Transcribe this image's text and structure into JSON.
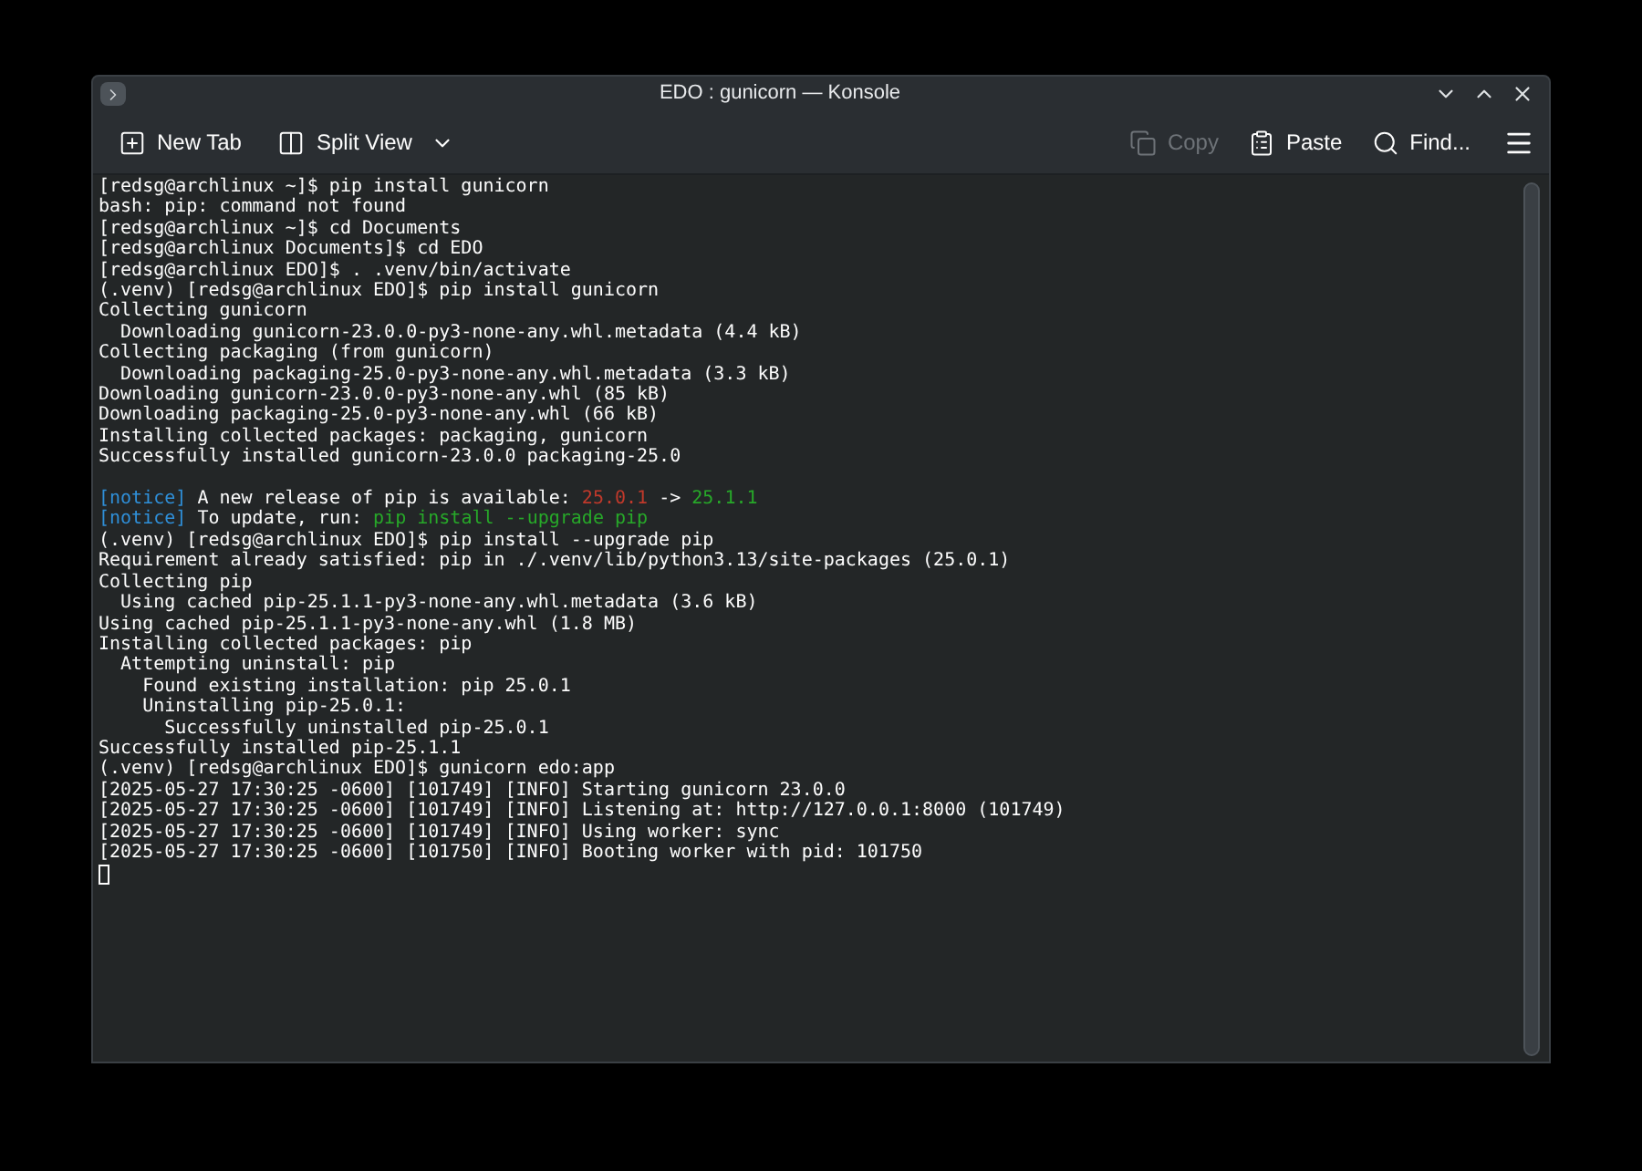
{
  "window": {
    "title": "EDO : gunicorn — Konsole"
  },
  "toolbar": {
    "left": [
      {
        "label": "New Tab",
        "kind": "newtab",
        "disabled": false
      },
      {
        "label": "Split View",
        "kind": "split",
        "disabled": false
      }
    ],
    "right": [
      {
        "label": "Copy",
        "kind": "copy",
        "disabled": true
      },
      {
        "label": "Paste",
        "kind": "paste",
        "disabled": false
      },
      {
        "label": "Find...",
        "kind": "find",
        "disabled": false
      }
    ]
  },
  "terminal": {
    "lines": [
      {
        "kind": "text",
        "spans": [
          {
            "text": "[redsg@archlinux ~]$ pip install gunicorn",
            "color": "#fcfcfc"
          }
        ]
      },
      {
        "kind": "text",
        "spans": [
          {
            "text": "bash: pip: command not found",
            "color": "#fcfcfc"
          }
        ]
      },
      {
        "kind": "text",
        "spans": [
          {
            "text": "[redsg@archlinux ~]$ cd Documents",
            "color": "#fcfcfc"
          }
        ]
      },
      {
        "kind": "text",
        "spans": [
          {
            "text": "[redsg@archlinux Documents]$ cd EDO",
            "color": "#fcfcfc"
          }
        ]
      },
      {
        "kind": "text",
        "spans": [
          {
            "text": "[redsg@archlinux EDO]$ . .venv/bin/activate",
            "color": "#fcfcfc"
          }
        ]
      },
      {
        "kind": "text",
        "spans": [
          {
            "text": "(.venv) [redsg@archlinux EDO]$ pip install gunicorn",
            "color": "#fcfcfc"
          }
        ]
      },
      {
        "kind": "text",
        "spans": [
          {
            "text": "Collecting gunicorn",
            "color": "#fcfcfc"
          }
        ]
      },
      {
        "kind": "text",
        "spans": [
          {
            "text": "  Downloading gunicorn-23.0.0-py3-none-any.whl.metadata (4.4 kB)",
            "color": "#fcfcfc"
          }
        ]
      },
      {
        "kind": "text",
        "spans": [
          {
            "text": "Collecting packaging (from gunicorn)",
            "color": "#fcfcfc"
          }
        ]
      },
      {
        "kind": "text",
        "spans": [
          {
            "text": "  Downloading packaging-25.0-py3-none-any.whl.metadata (3.3 kB)",
            "color": "#fcfcfc"
          }
        ]
      },
      {
        "kind": "text",
        "spans": [
          {
            "text": "Downloading gunicorn-23.0.0-py3-none-any.whl (85 kB)",
            "color": "#fcfcfc"
          }
        ]
      },
      {
        "kind": "text",
        "spans": [
          {
            "text": "Downloading packaging-25.0-py3-none-any.whl (66 kB)",
            "color": "#fcfcfc"
          }
        ]
      },
      {
        "kind": "text",
        "spans": [
          {
            "text": "Installing collected packages: packaging, gunicorn",
            "color": "#fcfcfc"
          }
        ]
      },
      {
        "kind": "text",
        "spans": [
          {
            "text": "Successfully installed gunicorn-23.0.0 packaging-25.0",
            "color": "#fcfcfc"
          }
        ]
      },
      {
        "kind": "blank"
      },
      {
        "kind": "text",
        "spans": [
          {
            "text": "[notice]",
            "color": "#2f8fd8"
          },
          {
            "text": " A new release of pip is available: ",
            "color": "#fcfcfc"
          },
          {
            "text": "25.0.1",
            "color": "#c0392b"
          },
          {
            "text": " -> ",
            "color": "#fcfcfc"
          },
          {
            "text": "25.1.1",
            "color": "#27a829"
          }
        ]
      },
      {
        "kind": "text",
        "spans": [
          {
            "text": "[notice]",
            "color": "#2f8fd8"
          },
          {
            "text": " To update, run: ",
            "color": "#fcfcfc"
          },
          {
            "text": "pip install --upgrade pip",
            "color": "#27a829"
          }
        ]
      },
      {
        "kind": "text",
        "spans": [
          {
            "text": "(.venv) [redsg@archlinux EDO]$ pip install --upgrade pip",
            "color": "#fcfcfc"
          }
        ]
      },
      {
        "kind": "text",
        "spans": [
          {
            "text": "Requirement already satisfied: pip in ./.venv/lib/python3.13/site-packages (25.0.1)",
            "color": "#fcfcfc"
          }
        ]
      },
      {
        "kind": "text",
        "spans": [
          {
            "text": "Collecting pip",
            "color": "#fcfcfc"
          }
        ]
      },
      {
        "kind": "text",
        "spans": [
          {
            "text": "  Using cached pip-25.1.1-py3-none-any.whl.metadata (3.6 kB)",
            "color": "#fcfcfc"
          }
        ]
      },
      {
        "kind": "text",
        "spans": [
          {
            "text": "Using cached pip-25.1.1-py3-none-any.whl (1.8 MB)",
            "color": "#fcfcfc"
          }
        ]
      },
      {
        "kind": "text",
        "spans": [
          {
            "text": "Installing collected packages: pip",
            "color": "#fcfcfc"
          }
        ]
      },
      {
        "kind": "text",
        "spans": [
          {
            "text": "  Attempting uninstall: pip",
            "color": "#fcfcfc"
          }
        ]
      },
      {
        "kind": "text",
        "spans": [
          {
            "text": "    Found existing installation: pip 25.0.1",
            "color": "#fcfcfc"
          }
        ]
      },
      {
        "kind": "text",
        "spans": [
          {
            "text": "    Uninstalling pip-25.0.1:",
            "color": "#fcfcfc"
          }
        ]
      },
      {
        "kind": "text",
        "spans": [
          {
            "text": "      Successfully uninstalled pip-25.0.1",
            "color": "#fcfcfc"
          }
        ]
      },
      {
        "kind": "text",
        "spans": [
          {
            "text": "Successfully installed pip-25.1.1",
            "color": "#fcfcfc"
          }
        ]
      },
      {
        "kind": "text",
        "spans": [
          {
            "text": "(.venv) [redsg@archlinux EDO]$ gunicorn edo:app",
            "color": "#fcfcfc"
          }
        ]
      },
      {
        "kind": "text",
        "spans": [
          {
            "text": "[2025-05-27 17:30:25 -0600] [101749] [INFO] Starting gunicorn 23.0.0",
            "color": "#fcfcfc"
          }
        ]
      },
      {
        "kind": "text",
        "spans": [
          {
            "text": "[2025-05-27 17:30:25 -0600] [101749] [INFO] Listening at: http://127.0.0.1:8000 (101749)",
            "color": "#fcfcfc"
          }
        ]
      },
      {
        "kind": "text",
        "spans": [
          {
            "text": "[2025-05-27 17:30:25 -0600] [101749] [INFO] Using worker: sync",
            "color": "#fcfcfc"
          }
        ]
      },
      {
        "kind": "text",
        "spans": [
          {
            "text": "[2025-05-27 17:30:25 -0600] [101750] [INFO] Booting worker with pid: 101750",
            "color": "#fcfcfc"
          }
        ]
      },
      {
        "kind": "cursor"
      }
    ]
  }
}
